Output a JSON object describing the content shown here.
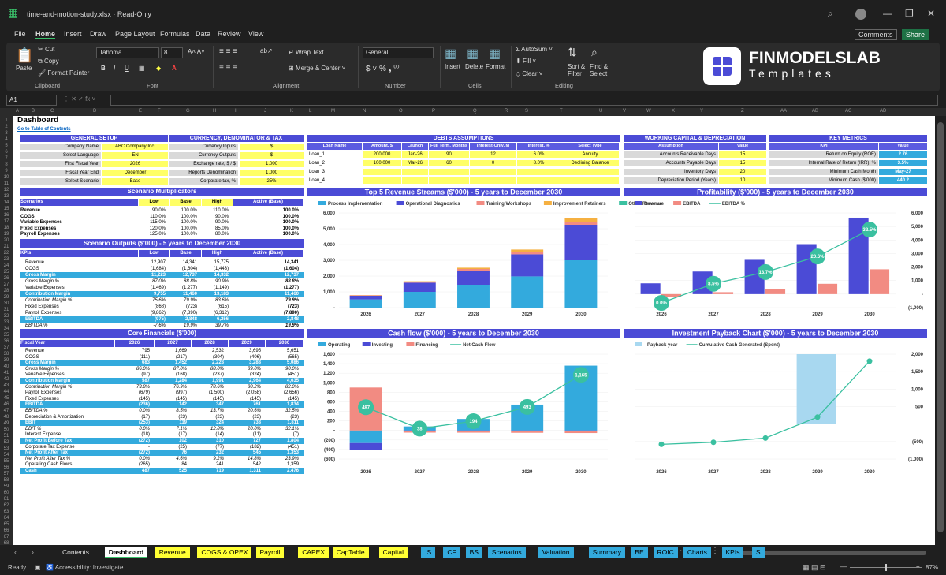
{
  "window": {
    "title": "time-and-motion-study.xlsx  ·  Read-Only"
  },
  "menu": [
    "File",
    "Home",
    "Insert",
    "Draw",
    "Page Layout",
    "Formulas",
    "Data",
    "Review",
    "View"
  ],
  "menu_right": {
    "comments": "Comments",
    "share": "Share"
  },
  "ribbon": {
    "paste": "Paste",
    "cut": "Cut",
    "copy": "Copy",
    "format_painter": "Format Painter",
    "clipboard": "Clipboard",
    "font": "Tahoma",
    "size": "8",
    "font_group": "Font",
    "wrap": "Wrap Text",
    "merge": "Merge & Center",
    "alignment": "Alignment",
    "numfmt": "General",
    "number": "Number",
    "insert": "Insert",
    "delete": "Delete",
    "format": "Format",
    "cells": "Cells",
    "autosum": "AutoSum",
    "fill": "Fill",
    "clear": "Clear",
    "sort": "Sort & Filter",
    "find": "Find & Select",
    "editing": "Editing"
  },
  "brand": {
    "name": "FINMODELSLAB",
    "sub": "Templates"
  },
  "namebox": "A1",
  "columns": [
    "A",
    "B",
    "C",
    "D",
    "E",
    "F",
    "G",
    "H",
    "I",
    "J",
    "K",
    "L",
    "M",
    "N",
    "O",
    "P",
    "Q",
    "R",
    "S",
    "T",
    "U",
    "V",
    "W",
    "X",
    "Y",
    "Z",
    "AA",
    "AB",
    "AC",
    "AD"
  ],
  "sheet": {
    "title": "Dashboard",
    "toc": "Go to Table of Contents",
    "general": {
      "title": "GENERAL SETUP",
      "rows": [
        [
          "Company Name",
          "ABC Company Inc."
        ],
        [
          "Select Language",
          "EN"
        ],
        [
          "First Fiscal Year",
          "2026"
        ],
        [
          "Fiscal Year End",
          "December"
        ],
        [
          "Select Scenario",
          "Base"
        ]
      ]
    },
    "currency": {
      "title": "CURRENCY, DENOMINATOR & TAX",
      "rows": [
        [
          "Currency Inputs",
          "$"
        ],
        [
          "Currency Outputs",
          "$"
        ],
        [
          "Exchange rate, $ / $",
          "1.000"
        ],
        [
          "Reports Denomination",
          "1,000"
        ],
        [
          "Corporate tax, %",
          "25%"
        ]
      ]
    },
    "debts": {
      "title": "DEBTS ASSUMPTIONS",
      "headers": [
        "Loan Name",
        "Amount, $",
        "Launch",
        "Full Term, Months",
        "Interest-Only, M",
        "Interest, %",
        "Select Type"
      ],
      "rows": [
        [
          "Loan_1",
          "200,000",
          "Jan-26",
          "90",
          "12",
          "6.0%",
          "Annuity"
        ],
        [
          "Loan_2",
          "100,000",
          "Mar-26",
          "60",
          "0",
          "8.0%",
          "Declining Balance"
        ],
        [
          "Loan_3",
          "",
          "",
          "",
          "",
          "",
          ""
        ],
        [
          "Loan_4",
          "",
          "",
          "",
          "",
          "",
          ""
        ]
      ]
    },
    "wc": {
      "title": "WORKING CAPITAL & DEPRECIATION",
      "headers": [
        "Assumption",
        "Value"
      ],
      "rows": [
        [
          "Accounts Receivable Days",
          "15"
        ],
        [
          "Accounts Payable Days",
          "15"
        ],
        [
          "Inventory Days",
          "20"
        ],
        [
          "Depreciation Period (Years)",
          "10"
        ]
      ]
    },
    "km": {
      "title": "KEY METRICS",
      "headers": [
        "KPI",
        "Value"
      ],
      "rows": [
        [
          "Return on Equity (ROE)",
          "2.76"
        ],
        [
          "Internal Rate of Return (IRR), %",
          "3.5%"
        ],
        [
          "Minimum Cash Month",
          "May-27"
        ],
        [
          "Minimum Cash ($'000)",
          "440.2"
        ]
      ]
    },
    "sm": {
      "title": "Scenario Multiplicators",
      "headers": [
        "Scenarios",
        "Low",
        "Base",
        "High",
        "Active (Base)"
      ],
      "rows": [
        [
          "Revenue",
          "90.0%",
          "100.0%",
          "110.0%",
          "100.0%"
        ],
        [
          "COGS",
          "110.0%",
          "100.0%",
          "90.0%",
          "100.0%"
        ],
        [
          "Variable Expenses",
          "115.0%",
          "100.0%",
          "90.0%",
          "100.0%"
        ],
        [
          "Fixed Expenses",
          "120.0%",
          "100.0%",
          "85.0%",
          "100.0%"
        ],
        [
          "Payroll Expenses",
          "125.0%",
          "100.0%",
          "80.0%",
          "100.0%"
        ]
      ]
    },
    "so": {
      "title": "Scenario Outputs ($'000) - 5 years to December 2030",
      "headers": [
        "KPIs",
        "Low",
        "Base",
        "High",
        "Active (Base)"
      ],
      "rows": [
        [
          "Revenue",
          "12,907",
          "14,341",
          "15,775",
          "14,341",
          "n"
        ],
        [
          "COGS",
          "(1,684)",
          "(1,604)",
          "(1,443)",
          "(1,604)",
          "n"
        ],
        [
          "Gross Margin",
          "11,223",
          "12,737",
          "14,332",
          "12,737",
          "b"
        ],
        [
          "Gross Margin %",
          "87.0%",
          "88.8%",
          "90.9%",
          "88.8%",
          "i"
        ],
        [
          "Variable Expenses",
          "(1,469)",
          "(1,277)",
          "(1,149)",
          "(1,277)",
          "n"
        ],
        [
          "Contribution Margin",
          "9,755",
          "11,460",
          "13,183",
          "11,460",
          "b"
        ],
        [
          "Contribution Margin %",
          "75.6%",
          "79.9%",
          "83.6%",
          "79.9%",
          "i"
        ],
        [
          "Fixed Expenses",
          "(868)",
          "(723)",
          "(615)",
          "(723)",
          "n"
        ],
        [
          "Payroll Expenses",
          "(9,862)",
          "(7,890)",
          "(6,312)",
          "(7,890)",
          "n"
        ],
        [
          "EBITDA",
          "(975)",
          "2,848",
          "6,256",
          "2,848",
          "b"
        ],
        [
          "EBITDA %",
          "-7.6%",
          "19.9%",
          "39.7%",
          "19.9%",
          "i"
        ]
      ]
    },
    "cf": {
      "title": "Core Financials ($'000)",
      "headers": [
        "Fiscal Year",
        "2026",
        "2027",
        "2028",
        "2029",
        "2030"
      ],
      "rows": [
        [
          "Revenue",
          "795",
          "1,669",
          "2,532",
          "3,695",
          "5,651",
          "n"
        ],
        [
          "COGS",
          "(111)",
          "(217)",
          "(304)",
          "(406)",
          "(565)",
          "n"
        ],
        [
          "Gross Margin",
          "683",
          "1,452",
          "2,228",
          "3,288",
          "5,086",
          "b"
        ],
        [
          "Gross Margin %",
          "86.0%",
          "87.0%",
          "88.0%",
          "89.0%",
          "90.0%",
          "i"
        ],
        [
          "Variable Expenses",
          "(97)",
          "(168)",
          "(237)",
          "(324)",
          "(451)",
          "n"
        ],
        [
          "Contribution Margin",
          "587",
          "1,284",
          "1,991",
          "2,964",
          "4,635",
          "b"
        ],
        [
          "Contribution Margin %",
          "73.8%",
          "76.9%",
          "78.6%",
          "80.2%",
          "82.0%",
          "i"
        ],
        [
          "Payroll Expenses",
          "(679)",
          "(997)",
          "(1,500)",
          "(2,058)",
          "(2,656)",
          "n"
        ],
        [
          "Fixed Expenses",
          "(145)",
          "(145)",
          "(145)",
          "(145)",
          "(145)",
          "n"
        ],
        [
          "EBITDA",
          "(236)",
          "142",
          "347",
          "761",
          "1,834",
          "b"
        ],
        [
          "EBITDA %",
          "0.0%",
          "8.5%",
          "13.7%",
          "20.6%",
          "32.5%",
          "i"
        ],
        [
          "Depreciation & Amortization",
          "(17)",
          "(23)",
          "(23)",
          "(23)",
          "(23)",
          "n"
        ],
        [
          "EBIT",
          "(253)",
          "119",
          "324",
          "738",
          "1,811",
          "b"
        ],
        [
          "EBIT %",
          "0.0%",
          "7.1%",
          "12.8%",
          "20.0%",
          "32.1%",
          "i"
        ],
        [
          "Interest Expense",
          "(18)",
          "(17)",
          "(14)",
          "(11)",
          "(7)",
          "n"
        ],
        [
          "Net Profit Before Tax",
          "(272)",
          "102",
          "310",
          "727",
          "1,804",
          "b"
        ],
        [
          "Corporate Tax Expense",
          "-",
          "(25)",
          "(77)",
          "(182)",
          "(451)",
          "n"
        ],
        [
          "Net Profit After Tax",
          "(272)",
          "76",
          "232",
          "545",
          "1,353",
          "b"
        ],
        [
          "Net Profit After Tax %",
          "0.0%",
          "4.6%",
          "9.2%",
          "14.8%",
          "23.9%",
          "i"
        ],
        [
          "Operating Cash Flows",
          "(265)",
          "84",
          "241",
          "542",
          "1,359",
          "n"
        ],
        [
          "Cash",
          "487",
          "525",
          "719",
          "1,311",
          "2,476",
          "b"
        ]
      ]
    }
  },
  "chart_data": [
    {
      "type": "bar",
      "stacked": true,
      "title": "Top 5 Revenue Streams ($'000) - 5 years to December 2030",
      "categories": [
        "2026",
        "2027",
        "2028",
        "2029",
        "2030"
      ],
      "ylim": [
        0,
        6000
      ],
      "yticks": [
        "-",
        "1,000",
        "2,000",
        "3,000",
        "4,000",
        "5,000",
        "6,000"
      ],
      "legend": "top",
      "series": [
        {
          "name": "Process Implementation",
          "color": "#33aadd",
          "values": [
            520,
            1000,
            1450,
            1980,
            3000
          ]
        },
        {
          "name": "Operational Diagnostics",
          "color": "#4b4bd6",
          "values": [
            230,
            580,
            900,
            1400,
            2250
          ]
        },
        {
          "name": "Training Workshops",
          "color": "#f28b82",
          "values": [
            30,
            60,
            100,
            150,
            200
          ]
        },
        {
          "name": "Improvement Retainers",
          "color": "#f5b041",
          "values": [
            15,
            30,
            80,
            150,
            200
          ]
        },
        {
          "name": "Other Revenue",
          "color": "#3ac0a0",
          "values": [
            0,
            0,
            0,
            0,
            0
          ]
        }
      ]
    },
    {
      "type": "bar",
      "title": "Profitability ($'000) - 5 years to December 2030",
      "categories": [
        "2026",
        "2027",
        "2028",
        "2029",
        "2030"
      ],
      "ylim": [
        -1000,
        6000
      ],
      "yticks": [
        "(1,000)",
        "-",
        "1,000",
        "2,000",
        "3,000",
        "4,000",
        "5,000",
        "6,000"
      ],
      "legend": "top",
      "series": [
        {
          "name": "Revenue",
          "color": "#4b4bd6",
          "values": [
            795,
            1669,
            2532,
            3695,
            5651
          ]
        },
        {
          "name": "EBITDA",
          "color": "#f28b82",
          "values": [
            -236,
            142,
            347,
            761,
            1834
          ]
        },
        {
          "name": "EBITDA %",
          "color": "#3ac0a0",
          "type": "line",
          "values": [
            0.0,
            8.5,
            13.7,
            20.6,
            32.5
          ],
          "labels": [
            "0.0%",
            "8.5%",
            "13.7%",
            "20.6%",
            "32.5%"
          ]
        }
      ]
    },
    {
      "type": "bar",
      "stacked": true,
      "title": "Cash flow ($'000) - 5 years to December 2030",
      "categories": [
        "2026",
        "2027",
        "2028",
        "2029",
        "2030"
      ],
      "ylim": [
        -600,
        1600
      ],
      "yticks": [
        "(600)",
        "(400)",
        "(200)",
        "-",
        "200",
        "400",
        "600",
        "800",
        "1,000",
        "1,200",
        "1,400",
        "1,600"
      ],
      "legend": "top",
      "series": [
        {
          "name": "Operating",
          "color": "#33aadd",
          "values": [
            -265,
            84,
            241,
            542,
            1359
          ]
        },
        {
          "name": "Investing",
          "color": "#4b4bd6",
          "values": [
            -150,
            -20,
            -20,
            -20,
            -20
          ]
        },
        {
          "name": "Financing",
          "color": "#f28b82",
          "values": [
            900,
            -26,
            -27,
            -30,
            -35
          ]
        },
        {
          "name": "Net Cash Flow",
          "color": "#3ac0a0",
          "type": "line",
          "values": [
            487,
            38,
            194,
            493,
            1165
          ],
          "labels": [
            "487",
            "38",
            "194",
            "493",
            "1,165"
          ]
        }
      ]
    },
    {
      "type": "line",
      "title": "Investment Payback Chart ($'000) - 5 years to December 2030",
      "categories": [
        "2026",
        "2027",
        "2028",
        "2029",
        "2030"
      ],
      "ylim": [
        -1000,
        2000
      ],
      "yticks": [
        "(1,000)",
        "(500)",
        "-",
        "500",
        "1,000",
        "1,500",
        "2,000"
      ],
      "legend": "top",
      "series": [
        {
          "name": "Payback year",
          "color": "#a8d8f0",
          "type": "bar",
          "values": [
            0,
            0,
            0,
            2000,
            0
          ]
        },
        {
          "name": "Cumulative Cash Generated (Spent)",
          "color": "#3ac0a0",
          "values": [
            -580,
            -520,
            -400,
            200,
            1800
          ]
        }
      ]
    }
  ],
  "tabs": [
    {
      "n": "Contents",
      "c": "#1f1f1f",
      "t": "#ddd"
    },
    {
      "n": "Dashboard",
      "c": "#ffffff",
      "t": "#000"
    },
    {
      "n": "Revenue",
      "c": "#ffff33",
      "t": "#000"
    },
    {
      "n": "COGS & OPEX",
      "c": "#ffff33",
      "t": "#000"
    },
    {
      "n": "Payroll",
      "c": "#ffff33",
      "t": "#000"
    },
    {
      "n": "CAPEX",
      "c": "#ffff33",
      "t": "#000"
    },
    {
      "n": "CapTable",
      "c": "#ffff33",
      "t": "#000"
    },
    {
      "n": "Capital",
      "c": "#ffff33",
      "t": "#000"
    },
    {
      "n": "IS",
      "c": "#33aadd",
      "t": "#000"
    },
    {
      "n": "CF",
      "c": "#33aadd",
      "t": "#000"
    },
    {
      "n": "BS",
      "c": "#33aadd",
      "t": "#000"
    },
    {
      "n": "Scenarios",
      "c": "#33aadd",
      "t": "#000"
    },
    {
      "n": "Valuation",
      "c": "#33aadd",
      "t": "#000"
    },
    {
      "n": "Summary",
      "c": "#33aadd",
      "t": "#000"
    },
    {
      "n": "BE",
      "c": "#33aadd",
      "t": "#000"
    },
    {
      "n": "ROIC",
      "c": "#33aadd",
      "t": "#000"
    },
    {
      "n": "Charts",
      "c": "#33aadd",
      "t": "#000"
    },
    {
      "n": "KPIs",
      "c": "#33aadd",
      "t": "#000"
    },
    {
      "n": "S",
      "c": "#33aadd",
      "t": "#000"
    }
  ],
  "status": {
    "ready": "Ready",
    "access": "Accessibility: Investigate",
    "zoom": "87%"
  }
}
